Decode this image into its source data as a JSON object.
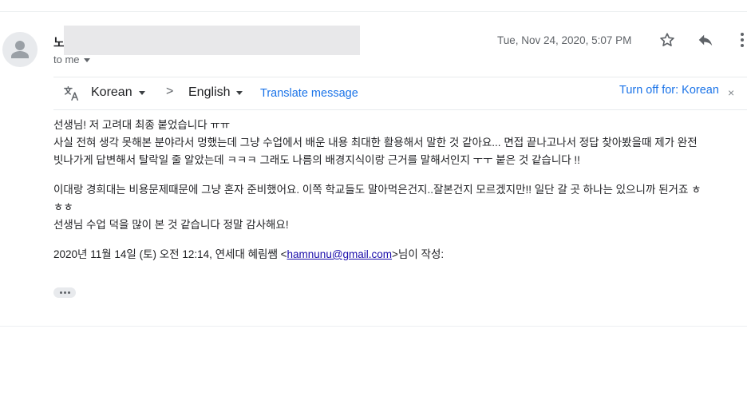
{
  "message": {
    "sender_name": "노",
    "recipient_label": "to me",
    "date": "Tue, Nov 24, 2020, 5:07 PM"
  },
  "translate_bar": {
    "source_language": "Korean",
    "arrow": ">",
    "target_language": "English",
    "translate_link": "Translate message",
    "turn_off_link": "Turn off for: Korean",
    "close": "×"
  },
  "body": {
    "lines": [
      "선생님! 저 고려대 최종 붙었습니다 ㅠㅠ",
      "사실 전혀 생각 못해본 분야라서 멍했는데 그냥 수업에서 배운 내용 최대한 활용해서 말한 것 같아요... 면접 끝나고나서 정답 찾아봤을때 제가 완전",
      "빗나가게 답변해서 탈락일 줄 알았는데 ㅋㅋㅋ 그래도 나름의 배경지식이랑 근거를 말해서인지 ㅜㅜ 붙은 것 같습니다 !!",
      "이대랑 경희대는 비용문제때문에 그냥 혼자 준비했어요. 이쪽 학교들도 말아먹은건지..잘본건지 모르겠지만!! 일단 갈 곳 하나는 있으니까 된거죠 ㅎ",
      "ㅎㅎ",
      "선생님 수업 덕을 많이 본 것 같습니다 정말 감사해요!"
    ],
    "quote_prefix": "2020년 11월 14일 (토) 오전 12:14, 연세대 혜림쌤 <",
    "quote_email": "hamnunu@gmail.com",
    "quote_suffix": ">님이 작성:"
  },
  "icons": {
    "avatar": "person-icon",
    "star": "star-icon",
    "reply": "reply-icon",
    "more": "more-vert-icon",
    "translate": "translate-icon",
    "show_trimmed": "ellipsis-icon"
  },
  "colors": {
    "link": "#1a73e8",
    "quote_link": "#1a0dab",
    "secondary_text": "#5f6368",
    "primary_text": "#202124"
  }
}
